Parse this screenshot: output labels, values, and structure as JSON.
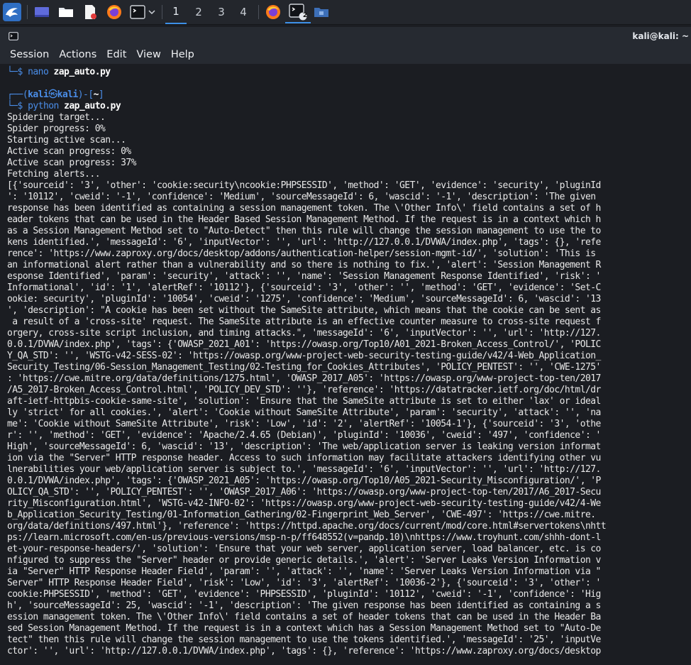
{
  "taskbar": {
    "workspaces": [
      "1",
      "2",
      "3",
      "4"
    ],
    "terminal_badge": "2"
  },
  "window": {
    "title": "kali@kali: ~",
    "menu": [
      "Session",
      "Actions",
      "Edit",
      "View",
      "Help"
    ]
  },
  "terminal": {
    "prev_command": "nano",
    "prev_command_arg": "zap_auto.py",
    "prompt_user": "kali",
    "prompt_at": "㉿",
    "prompt_host": "kali",
    "prompt_dir": "~",
    "command": "python",
    "command_arg": "zap_auto.py",
    "output": [
      "Spidering target...",
      "Spider progress: 0%",
      "Starting active scan...",
      "Active scan progress: 0%",
      "Active scan progress: 37%",
      "Fetching alerts...",
      "[{'sourceid': '3', 'other': 'cookie:security\\ncookie:PHPSESSID', 'method': 'GET', 'evidence': 'security', 'pluginId",
      "': '10112', 'cweid': '-1', 'confidence': 'Medium', 'sourceMessageId': 6, 'wascid': '-1', 'description': 'The given",
      "response has been identified as containing a session management token. The \\'Other Info\\' field contains a set of h",
      "eader tokens that can be used in the Header Based Session Management Method. If the request is in a context which h",
      "as a Session Management Method set to \"Auto-Detect\" then this rule will change the session management to use the to",
      "kens identified.', 'messageId': '6', 'inputVector': '', 'url': 'http://127.0.0.1/DVWA/index.php', 'tags': {}, 'refe",
      "rence': 'https://www.zaproxy.org/docs/desktop/addons/authentication-helper/session-mgmt-id/', 'solution': 'This is",
      "an informational alert rather than a vulnerability and so there is nothing to fix.', 'alert': 'Session Management R",
      "esponse Identified', 'param': 'security', 'attack': '', 'name': 'Session Management Response Identified', 'risk': '",
      "Informational', 'id': '1', 'alertRef': '10112'}, {'sourceid': '3', 'other': '', 'method': 'GET', 'evidence': 'Set-C",
      "ookie: security', 'pluginId': '10054', 'cweid': '1275', 'confidence': 'Medium', 'sourceMessageId': 6, 'wascid': '13",
      "', 'description': \"A cookie has been set without the SameSite attribute, which means that the cookie can be sent as",
      " a result of a 'cross-site' request. The SameSite attribute is an effective counter measure to cross-site request f",
      "orgery, cross-site script inclusion, and timing attacks.\", 'messageId': '6', 'inputVector': '', 'url': 'http://127.",
      "0.0.1/DVWA/index.php', 'tags': {'OWASP_2021_A01': 'https://owasp.org/Top10/A01_2021-Broken_Access_Control/', 'POLIC",
      "Y_QA_STD': '', 'WSTG-v42-SESS-02': 'https://owasp.org/www-project-web-security-testing-guide/v42/4-Web_Application_",
      "Security_Testing/06-Session_Management_Testing/02-Testing_for_Cookies_Attributes', 'POLICY_PENTEST': '', 'CWE-1275'",
      ": 'https://cwe.mitre.org/data/definitions/1275.html', 'OWASP_2017_A05': 'https://owasp.org/www-project-top-ten/2017",
      "/A5_2017-Broken_Access_Control.html', 'POLICY_DEV_STD': ''}, 'reference': 'https://datatracker.ietf.org/doc/html/dr",
      "aft-ietf-httpbis-cookie-same-site', 'solution': 'Ensure that the SameSite attribute is set to either 'lax' or ideal",
      "ly 'strict' for all cookies.', 'alert': 'Cookie without SameSite Attribute', 'param': 'security', 'attack': '', 'na",
      "me': 'Cookie without SameSite Attribute', 'risk': 'Low', 'id': '2', 'alertRef': '10054-1'}, {'sourceid': '3', 'othe",
      "r': '', 'method': 'GET', 'evidence': 'Apache/2.4.65 (Debian)', 'pluginId': '10036', 'cweid': '497', 'confidence': '",
      "High', 'sourceMessageId': 6, 'wascid': '13', 'description': 'The web/application server is leaking version informat",
      "ion via the \"Server\" HTTP response header. Access to such information may facilitate attackers identifying other vu",
      "lnerabilities your web/application server is subject to.', 'messageId': '6', 'inputVector': '', 'url': 'http://127.",
      "0.0.1/DVWA/index.php', 'tags': {'OWASP_2021_A05': 'https://owasp.org/Top10/A05_2021-Security_Misconfiguration/', 'P",
      "OLICY_QA_STD': '', 'POLICY_PENTEST': '', 'OWASP_2017_A06': 'https://owasp.org/www-project-top-ten/2017/A6_2017-Secu",
      "rity_Misconfiguration.html', 'WSTG-v42-INFO-02': 'https://owasp.org/www-project-web-security-testing-guide/v42/4-We",
      "b_Application_Security_Testing/01-Information_Gathering/02-Fingerprint_Web_Server', 'CWE-497': 'https://cwe.mitre.",
      "org/data/definitions/497.html'}, 'reference': 'https://httpd.apache.org/docs/current/mod/core.html#servertokens\\nhtt",
      "ps://learn.microsoft.com/en-us/previous-versions/msp-n-p/ff648552(v=pandp.10)\\nhttps://www.troyhunt.com/shhh-dont-l",
      "et-your-response-headers/', 'solution': 'Ensure that your web server, application server, load balancer, etc. is co",
      "nfigured to suppress the \"Server\" header or provide generic details.', 'alert': 'Server Leaks Version Information v",
      "ia \"Server\" HTTP Response Header Field', 'param': '', 'attack': '', 'name': 'Server Leaks Version Information via \"",
      "Server\" HTTP Response Header Field', 'risk': 'Low', 'id': '3', 'alertRef': '10036-2'}, {'sourceid': '3', 'other': '",
      "cookie:PHPSESSID', 'method': 'GET', 'evidence': 'PHPSESSID', 'pluginId': '10112', 'cweid': '-1', 'confidence': 'Hig",
      "h', 'sourceMessageId': 25, 'wascid': '-1', 'description': 'The given response has been identified as containing a s",
      "ession management token. The \\'Other Info\\' field contains a set of header tokens that can be used in the Header Ba",
      "sed Session Management Method. If the request is in a context which has a Session Management Method set to \"Auto-De",
      "tect\" then this rule will change the session management to use the tokens identified.', 'messageId': '25', 'inputVe",
      "ctor': '', 'url': 'http://127.0.0.1/DVWA/index.php', 'tags': {}, 'reference': 'https://www.zaproxy.org/docs/desktop"
    ]
  }
}
